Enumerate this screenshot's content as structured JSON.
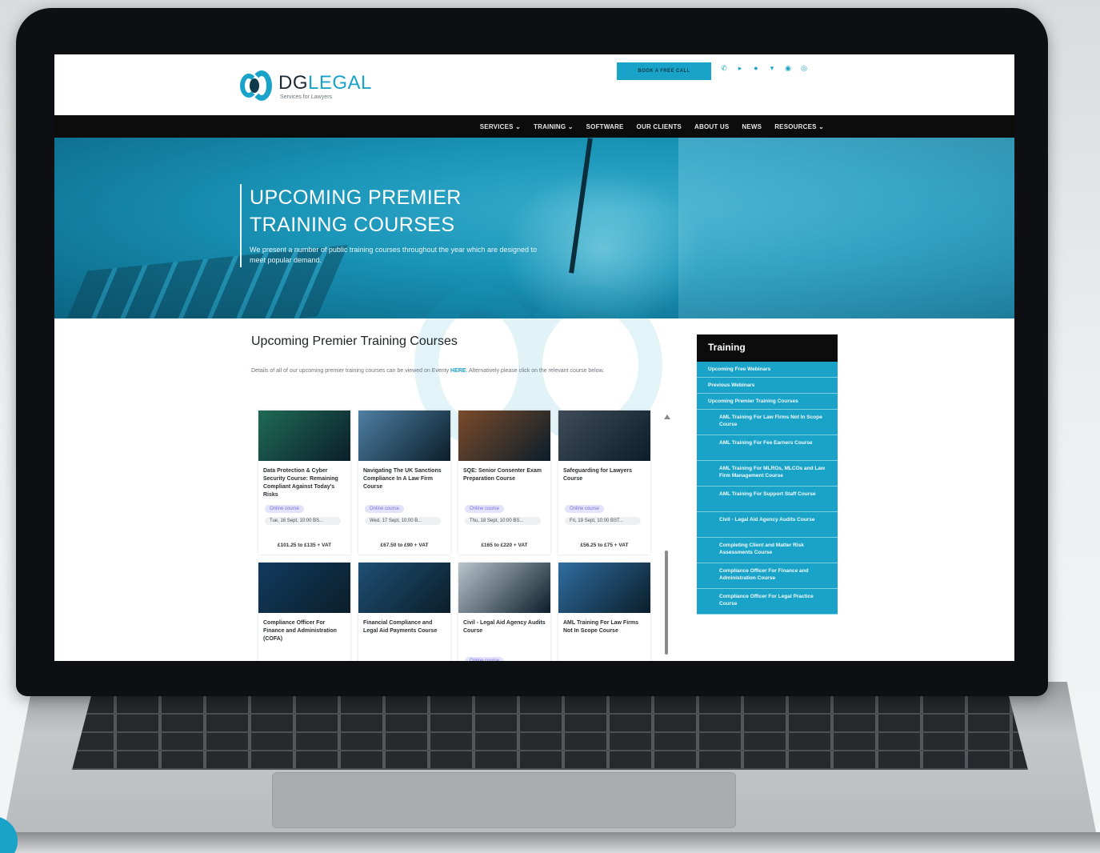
{
  "header": {
    "logo_dg": "DG",
    "logo_legal": "LEGAL",
    "logo_tagline": "Services for Lawyers",
    "book_call": "BOOK A FREE CALL",
    "social_icons": [
      "phone-icon",
      "linkedin-icon",
      "facebook-icon",
      "twitter-icon",
      "instagram-icon",
      "youtube-icon"
    ]
  },
  "nav": {
    "items": [
      "SERVICES ⌄",
      "TRAINING ⌄",
      "SOFTWARE",
      "OUR CLIENTS",
      "ABOUT US",
      "NEWS",
      "RESOURCES ⌄"
    ]
  },
  "hero": {
    "title": "UPCOMING PREMIER TRAINING COURSES",
    "subtitle": "We present a number of public training courses throughout the year which are designed to meet popular demand."
  },
  "main": {
    "title": "Upcoming Premier Training Courses",
    "desc_before": "Details of all of our upcoming premier training courses can be viewed on Eventy ",
    "desc_link": "HERE",
    "desc_after": ". Alternatively please click on the relevant course below."
  },
  "cards": [
    {
      "title": "Data Protection & Cyber Security Course: Remaining Compliant Against Today's Risks",
      "badge": "Online course",
      "date": "Tue, 16 Sept, 10:00 BS...",
      "price": "£101.25 to £135 + VAT",
      "img_color": "#1f6a55"
    },
    {
      "title": "Navigating The UK Sanctions Compliance In A Law Firm Course",
      "badge": "Online course",
      "date": "Wed, 17 Sept, 10:00 B...",
      "price": "£67.50 to £90 + VAT",
      "img_color": "#4e7fa3"
    },
    {
      "title": "SQE: Senior Consenter Exam Preparation Course",
      "badge": "Online course",
      "date": "Thu, 18 Sept, 10:00 BS...",
      "price": "£165 to £220 + VAT",
      "img_color": "#7a4a2a"
    },
    {
      "title": "Safeguarding for Lawyers Course",
      "badge": "Online course",
      "date": "Fri, 19 Sept, 10:00 BST...",
      "price": "£56.25 to £75 + VAT",
      "img_color": "#3f4b58"
    },
    {
      "title": "Compliance Officer For Finance and Administration (COFA)",
      "badge": "",
      "date": "",
      "price": "",
      "img_color": "#123a5e"
    },
    {
      "title": "Financial Compliance and Legal Aid Payments Course",
      "badge": "",
      "date": "",
      "price": "",
      "img_color": "#1e4f73"
    },
    {
      "title": "Civil - Legal Aid Agency Audits Course",
      "badge": "Online course",
      "date": "",
      "price": "",
      "img_color": "#b9c4cc"
    },
    {
      "title": "AML Training For Law Firms Not In Scope Course",
      "badge": "",
      "date": "",
      "price": "",
      "img_color": "#2f6da0"
    }
  ],
  "sidebar": {
    "title": "Training",
    "items": [
      {
        "label": "Upcoming Free Webinars",
        "sub": false
      },
      {
        "label": "Previous Webinars",
        "sub": false
      },
      {
        "label": "Upcoming Premier Training Courses",
        "sub": false
      },
      {
        "label": "AML Training For Law Firms Not In Scope Course",
        "sub": true
      },
      {
        "label": "AML Training For Fee Earners Course",
        "sub": true
      },
      {
        "label": "AML Training For MLROs, MLCOs and Law Firm Management Course",
        "sub": true
      },
      {
        "label": "AML Training For Support Staff Course",
        "sub": true
      },
      {
        "label": "Civil - Legal Aid Agency Audits Course",
        "sub": true
      },
      {
        "label": "Completing Client and Matter Risk Assessments Course",
        "sub": true
      },
      {
        "label": "Compliance Officer For Finance and Administration Course",
        "sub": true
      },
      {
        "label": "Compliance Officer For Legal Practice Course",
        "sub": true
      }
    ]
  }
}
